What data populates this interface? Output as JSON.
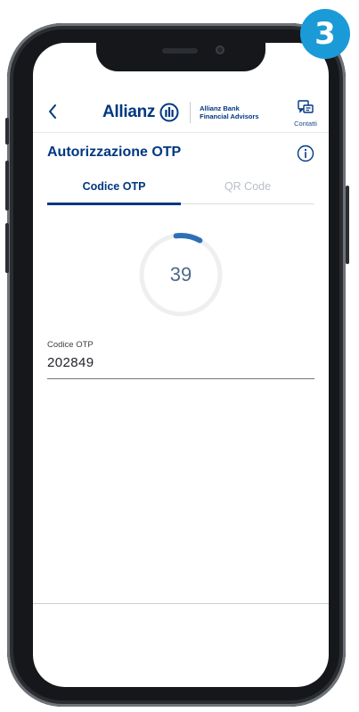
{
  "step_badge": "3",
  "header": {
    "brand": "Allianz",
    "bank_name_line1": "Allianz Bank",
    "bank_name_line2": "Financial Advisors",
    "contacts_label": "Contatti"
  },
  "page": {
    "title": "Autorizzazione OTP"
  },
  "tabs": [
    {
      "label": "Codice OTP",
      "active": true
    },
    {
      "label": "QR Code",
      "active": false
    }
  ],
  "timer": {
    "seconds": "39",
    "remaining_fraction": 0.1
  },
  "otp_field": {
    "label": "Codice OTP",
    "value": "202849"
  },
  "colors": {
    "brand": "#003781",
    "accent": "#1a9bd7"
  },
  "icons": [
    "back-icon",
    "allianz-logo-icon",
    "chat-icon",
    "info-icon"
  ]
}
